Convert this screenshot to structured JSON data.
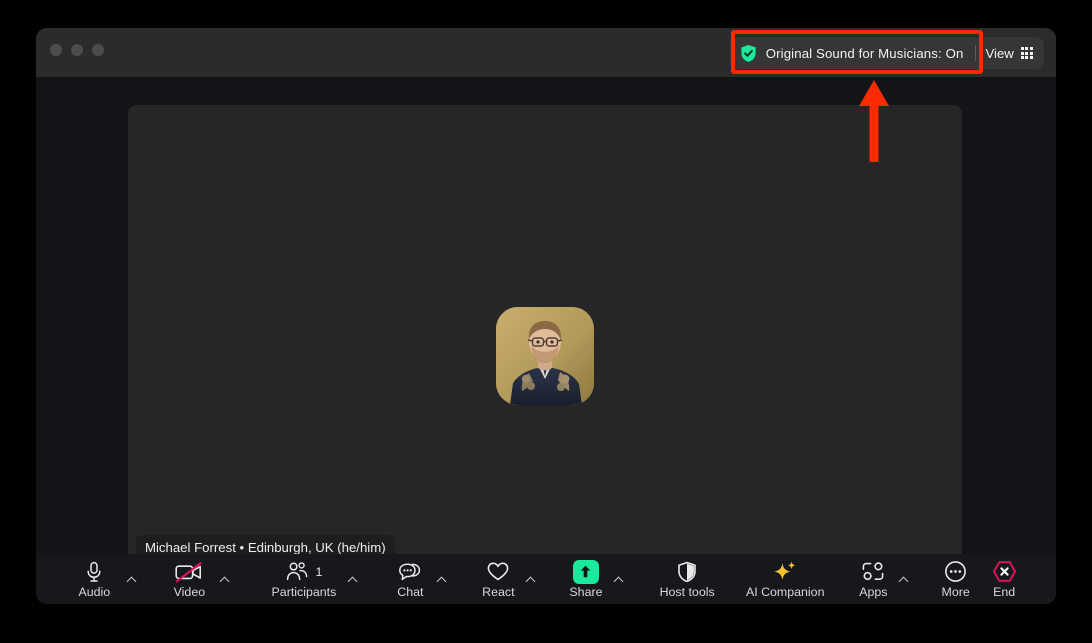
{
  "window": {
    "traffic_lights": [
      "close",
      "minimize",
      "zoom"
    ],
    "titlebar": {
      "original_sound": {
        "label": "Original Sound for Musicians: On",
        "icon": "shield-check-icon",
        "state": "On",
        "accent_color": "#18e99a"
      },
      "view": {
        "label": "View",
        "icon": "grid-view-icon"
      }
    }
  },
  "stage": {
    "participant": {
      "name_badge": "Michael Forrest • Edinburgh, UK (he/him)",
      "avatar": "user-avatar"
    }
  },
  "toolbar": {
    "items": [
      {
        "key": "audio",
        "label": "Audio",
        "icon": "microphone-icon",
        "chevron": true,
        "badge": ""
      },
      {
        "key": "video",
        "label": "Video",
        "icon": "video-off-icon",
        "chevron": true,
        "badge": ""
      },
      {
        "key": "participants",
        "label": "Participants",
        "icon": "participants-icon",
        "chevron": true,
        "badge": "1"
      },
      {
        "key": "chat",
        "label": "Chat",
        "icon": "chat-icon",
        "chevron": true,
        "badge": ""
      },
      {
        "key": "react",
        "label": "React",
        "icon": "heart-icon",
        "chevron": true,
        "badge": ""
      },
      {
        "key": "share",
        "label": "Share",
        "icon": "share-screen-icon",
        "chevron": true,
        "badge": ""
      },
      {
        "key": "host-tools",
        "label": "Host tools",
        "icon": "shield-icon",
        "chevron": false,
        "badge": ""
      },
      {
        "key": "ai-companion",
        "label": "AI Companion",
        "icon": "sparkle-icon",
        "chevron": false,
        "badge": ""
      },
      {
        "key": "apps",
        "label": "Apps",
        "icon": "apps-icon",
        "chevron": true,
        "badge": ""
      },
      {
        "key": "more",
        "label": "More",
        "icon": "ellipsis-icon",
        "chevron": false,
        "badge": ""
      },
      {
        "key": "end",
        "label": "End",
        "icon": "end-call-icon",
        "chevron": false,
        "badge": ""
      }
    ],
    "colors": {
      "share_accent": "#18e99a",
      "ai_accent": "#f5c22b",
      "end_accent": "#e8105a",
      "video_off_slash": "#e8105a"
    }
  },
  "annotation": {
    "highlight_target": "Original Sound for Musicians: On",
    "highlight_color": "#fc2a00",
    "arrow": "arrow-up",
    "arrow_color": "#fc2a00"
  }
}
